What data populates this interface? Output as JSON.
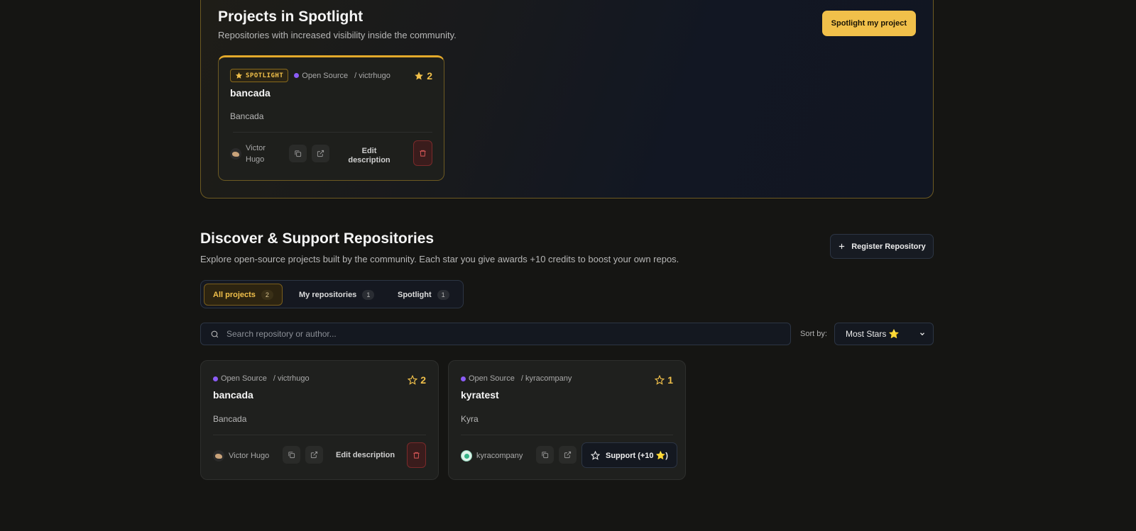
{
  "spotlight": {
    "title": "Projects in Spotlight",
    "subtitle": "Repositories with increased visibility inside the community.",
    "button": "Spotlight my project",
    "card": {
      "badge": "SPOTLIGHT",
      "license": "Open Source",
      "owner": "/ victrhugo",
      "stars": "2",
      "name": "bancada",
      "description": "Bancada",
      "author_line1": "Victor",
      "author_line2": "Hugo",
      "edit_line1": "Edit",
      "edit_line2": "description"
    }
  },
  "discover": {
    "title": "Discover & Support Repositories",
    "subtitle": "Explore open-source projects built by the community. Each star you give awards +10 credits to boost your own repos.",
    "register_button": "Register Repository",
    "tabs": [
      {
        "label": "All projects",
        "count": "2",
        "active": true
      },
      {
        "label": "My repositories",
        "count": "1",
        "active": false
      },
      {
        "label": "Spotlight",
        "count": "1",
        "active": false
      }
    ],
    "search_placeholder": "Search repository or author...",
    "sort_label": "Sort by:",
    "sort_value": "Most Stars ⭐",
    "cards": [
      {
        "license": "Open Source",
        "owner": "/ victrhugo",
        "stars": "2",
        "name": "bancada",
        "description": "Bancada",
        "author": "Victor Hugo",
        "action": "Edit description"
      },
      {
        "license": "Open Source",
        "owner": "/ kyracompany",
        "stars": "1",
        "name": "kyratest",
        "description": "Kyra",
        "author": "kyracompany",
        "action": "Support (+10 ⭐)"
      }
    ]
  },
  "colors": {
    "accent": "#f1c04a",
    "background": "#151513",
    "license_dot": "#8b5cf6",
    "danger": "#e05a5a"
  }
}
